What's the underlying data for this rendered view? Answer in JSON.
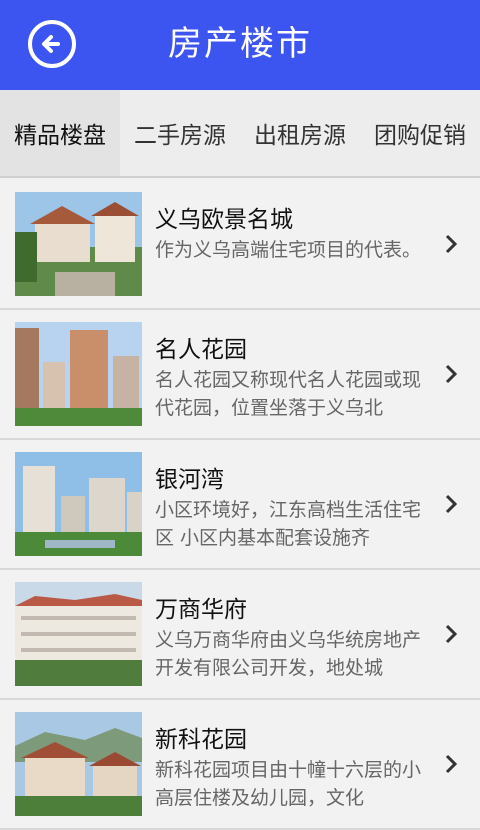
{
  "header": {
    "title": "房产楼市",
    "back_icon": "back-arrow-icon",
    "color": "#3d55f0"
  },
  "tabs": [
    {
      "label": "精品楼盘",
      "active": true
    },
    {
      "label": "二手房源",
      "active": false
    },
    {
      "label": "出租房源",
      "active": false
    },
    {
      "label": "团购促销",
      "active": false
    }
  ],
  "listings": [
    {
      "name": "义乌欧景名城",
      "description": "作为义乌高端住宅项目的代表。"
    },
    {
      "name": "名人花园",
      "description": "名人花园又称现代名人花园或现代花园，位置坐落于义乌北"
    },
    {
      "name": "银河湾",
      "description": "小区环境好，江东高档生活住宅区 小区内基本配套设施齐"
    },
    {
      "name": "万商华府",
      "description": "义乌万商华府由义乌华统房地产开发有限公司开发，地处城"
    },
    {
      "name": "新科花园",
      "description": "新科花园项目由十幢十六层的小高层住楼及幼儿园，文化"
    }
  ]
}
